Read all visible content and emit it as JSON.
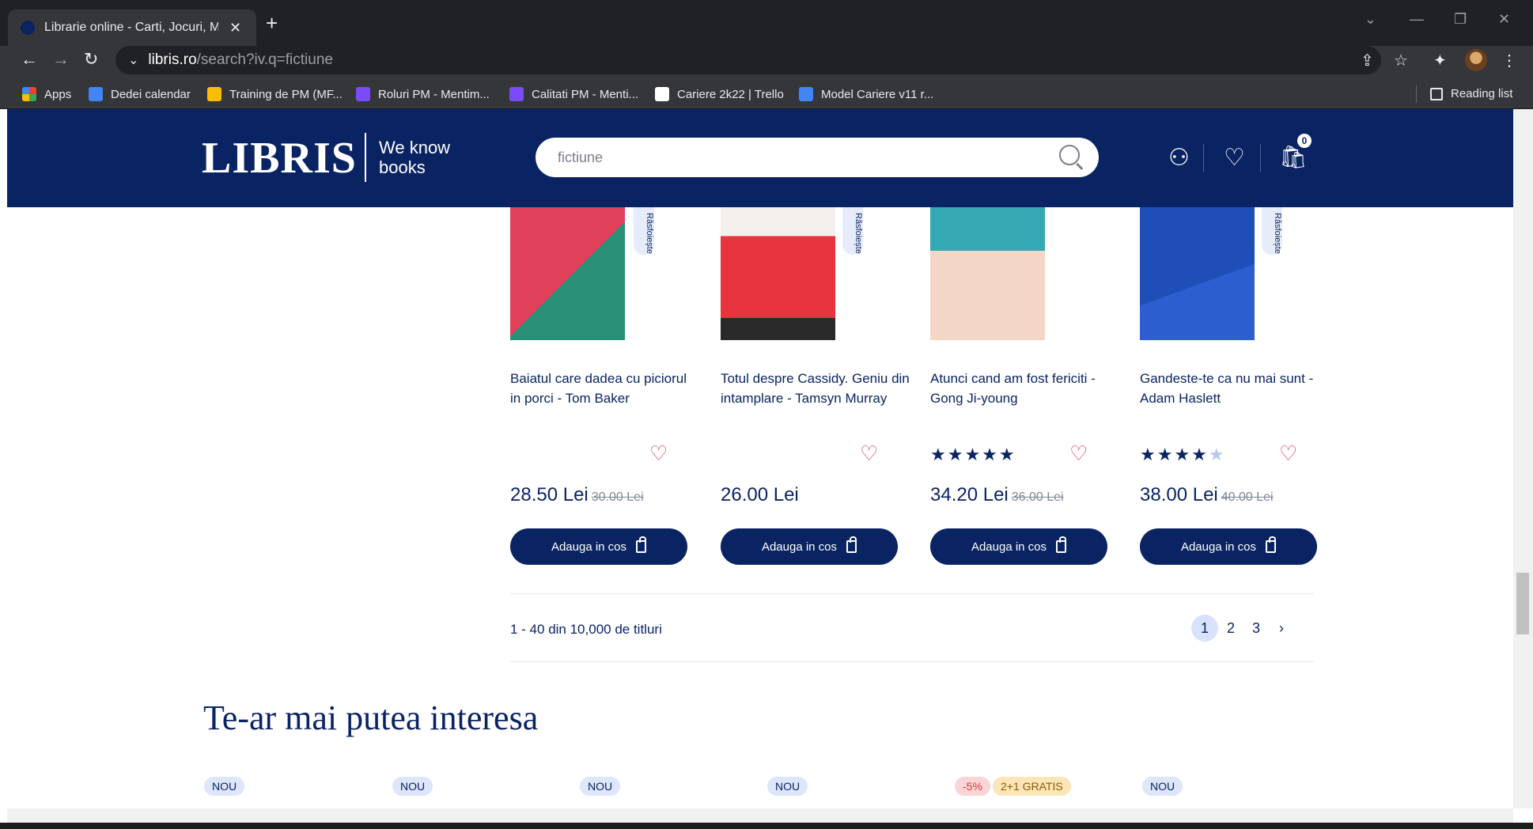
{
  "browser": {
    "tab_title": "Librarie online - Carti, Jocuri, Muzica",
    "tab_close": "✕",
    "new_tab": "+",
    "url_host": "libris.ro",
    "url_path": "/search?iv.q=fictiune",
    "bookmarks": [
      {
        "label": "Apps",
        "color": "#ea4335"
      },
      {
        "label": "Dedei calendar",
        "color": "#4285f4"
      },
      {
        "label": "Training de PM (MF...",
        "color": "#fbbc04"
      },
      {
        "label": "Roluri PM - Mentim...",
        "color": "#7b4cf5"
      },
      {
        "label": "Calitati PM - Menti...",
        "color": "#7b4cf5"
      },
      {
        "label": "Cariere 2k22 | Trello",
        "color": "#ffffff"
      },
      {
        "label": "Model Cariere v11 r...",
        "color": "#4285f4"
      }
    ],
    "reading_list": "Reading list"
  },
  "header": {
    "logo": "LIBRIS",
    "tagline_line1": "We know",
    "tagline_line2": "books",
    "search_value": "fictiune",
    "cart_count": "0",
    "colors": {
      "navy": "#0a2463"
    }
  },
  "products": [
    {
      "title": "Baiatul care dadea cu piciorul in porci - Tom Baker",
      "price": "28.50 Lei",
      "old_price": "30.00 Lei",
      "rating": null,
      "badge": "Răsfoiește",
      "button": "Adauga in cos"
    },
    {
      "title": "Totul despre Cassidy. Geniu din intamplare - Tamsyn Murray",
      "price": "26.00 Lei",
      "old_price": "",
      "rating": null,
      "badge": "Răsfoiește",
      "button": "Adauga in cos"
    },
    {
      "title": "Atunci cand am fost fericiti - Gong Ji-young",
      "price": "34.20 Lei",
      "old_price": "36.00 Lei",
      "rating": 5,
      "badge": "",
      "button": "Adauga in cos"
    },
    {
      "title": "Gandeste-te ca nu mai sunt - Adam Haslett",
      "price": "38.00 Lei",
      "old_price": "40.00 Lei",
      "rating": 4,
      "badge": "Răsfoiește",
      "button": "Adauga in cos"
    }
  ],
  "pagination": {
    "results_text": "1 - 40 din 10,000 de titluri",
    "pages": [
      "1",
      "2",
      "3"
    ],
    "next": "›"
  },
  "recommend": {
    "title": "Te-ar mai putea interesa",
    "tags": [
      "NOU",
      "NOU",
      "NOU",
      "NOU",
      "-5%",
      "2+1 GRATIS",
      "NOU"
    ]
  }
}
